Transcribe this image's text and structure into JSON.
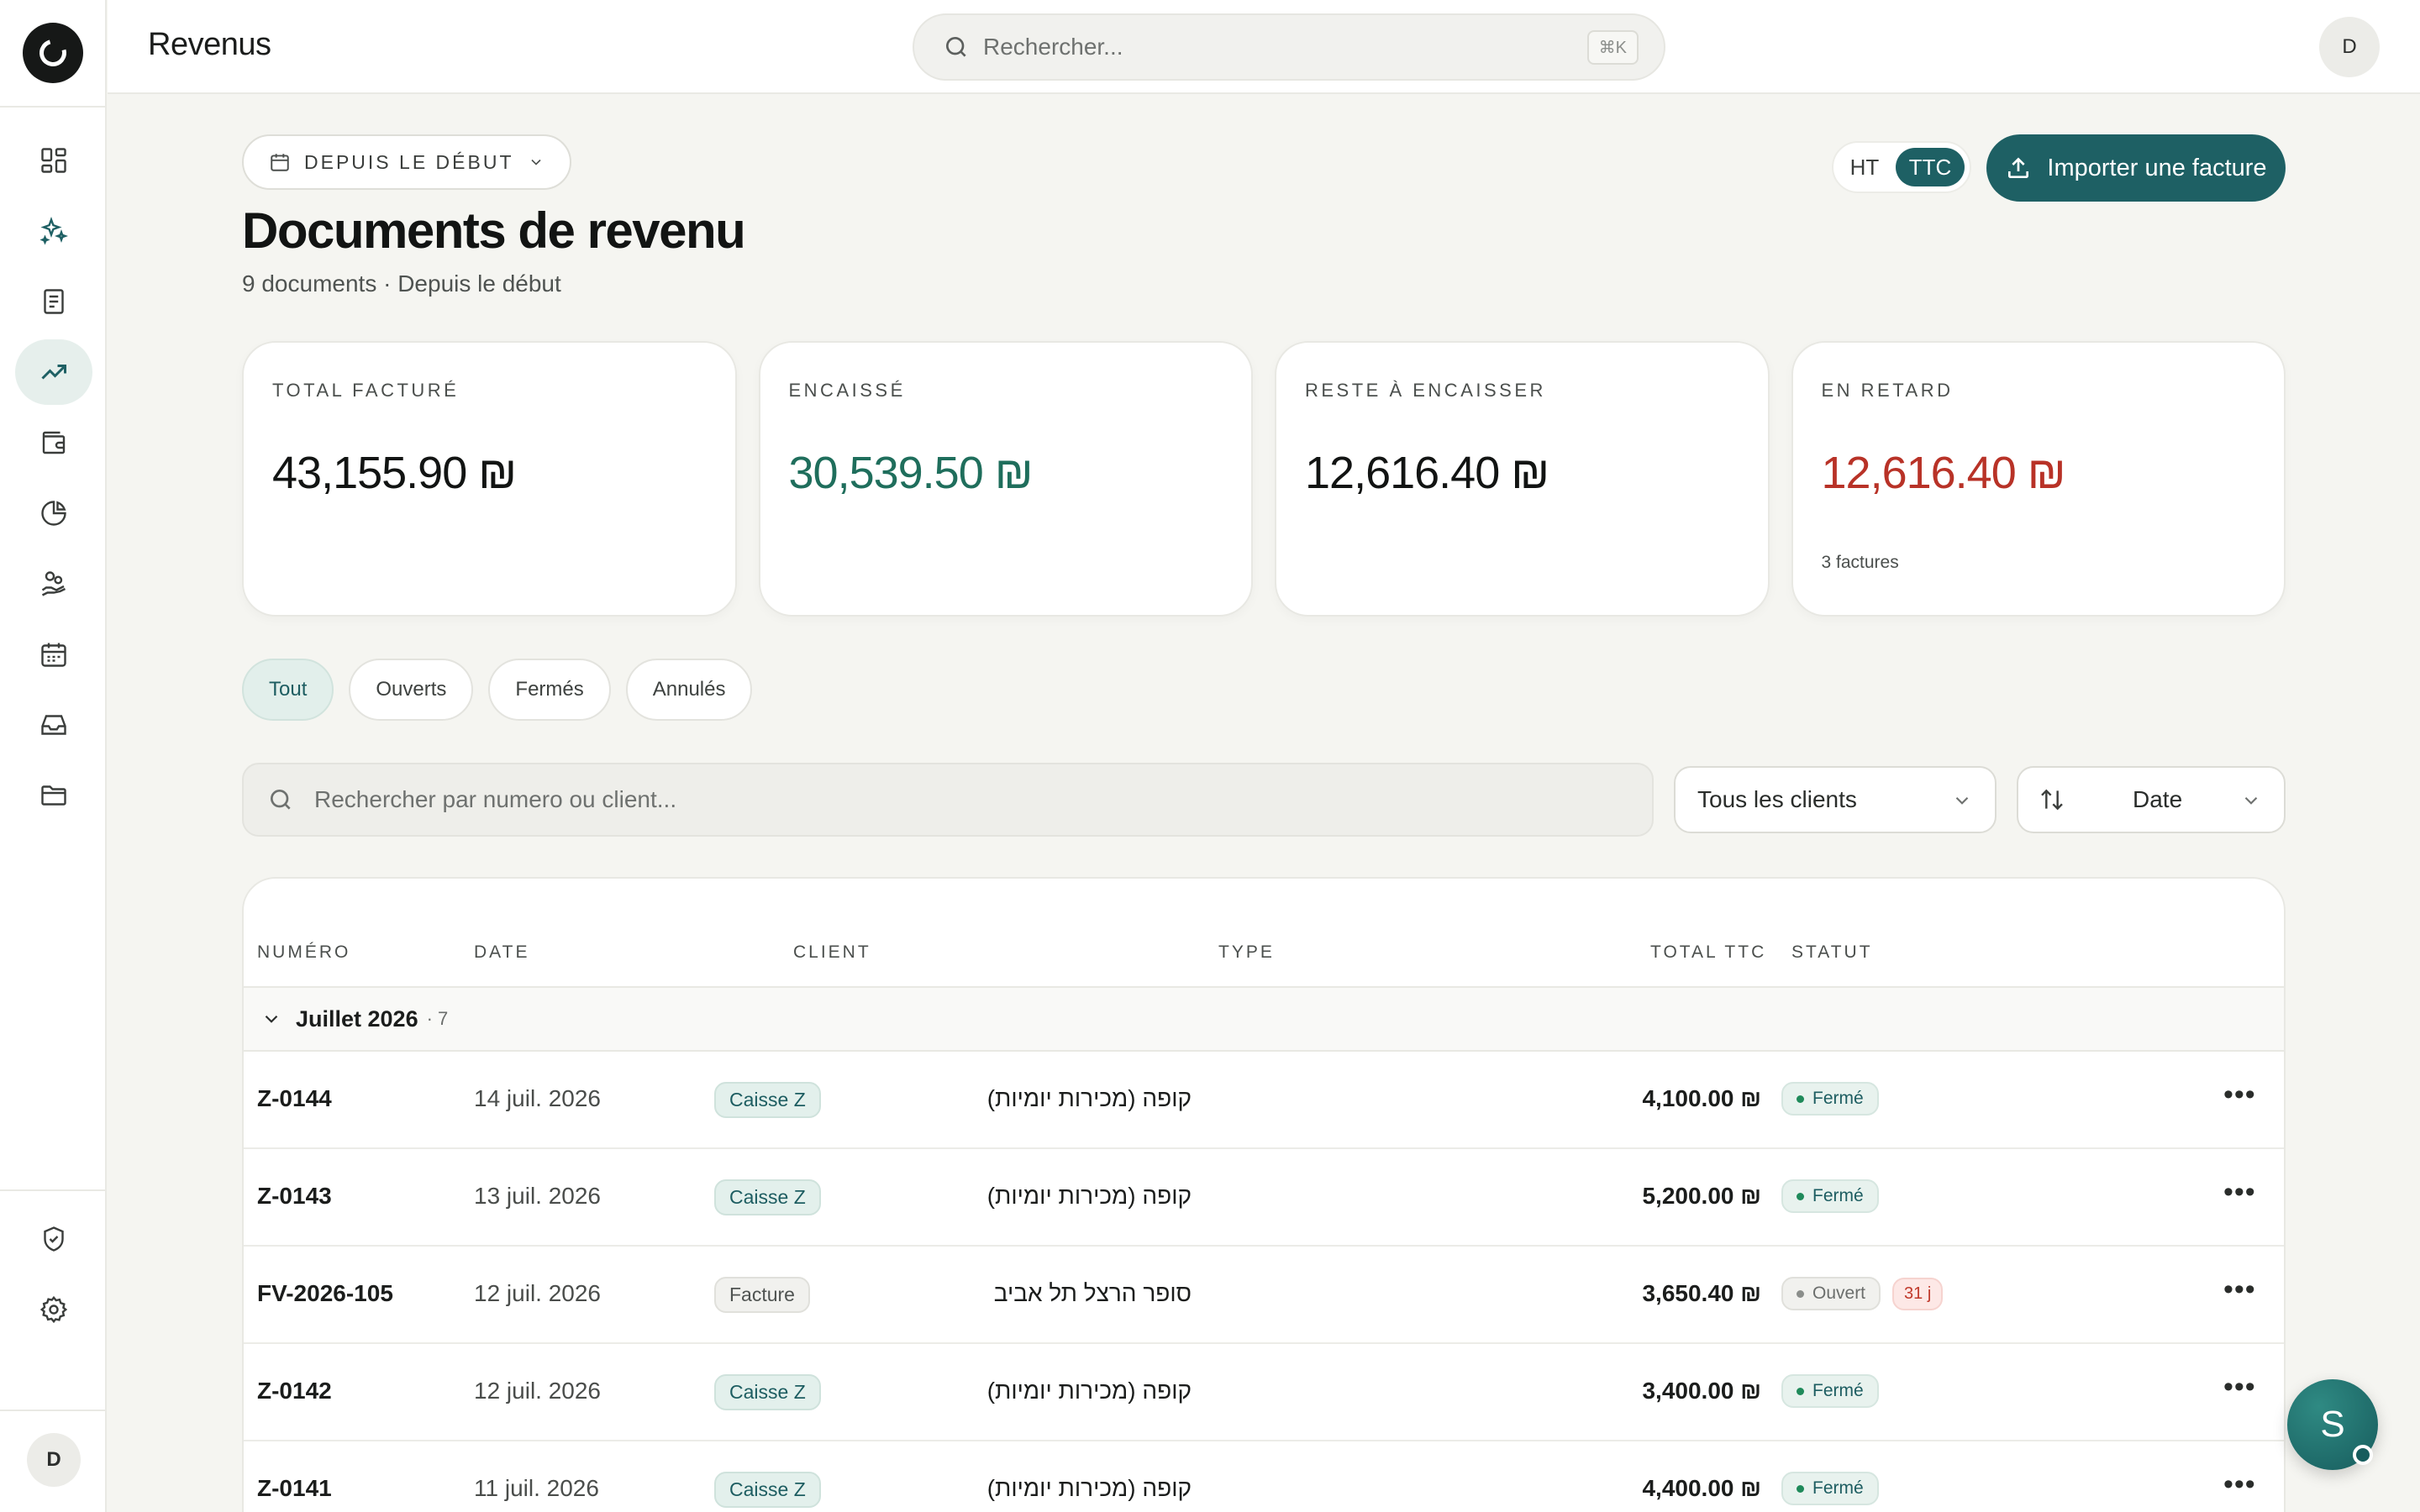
{
  "topbar": {
    "title": "Revenus",
    "search_placeholder": "Rechercher...",
    "search_shortcut": "⌘K",
    "avatar_initial": "D"
  },
  "sidebar": {
    "avatar_initial": "D",
    "items": [
      {
        "icon": "dashboard-grid-icon",
        "active": false
      },
      {
        "icon": "sparkles-icon",
        "active": false
      },
      {
        "icon": "document-icon",
        "active": false
      },
      {
        "icon": "trending-up-icon",
        "active": true
      },
      {
        "icon": "wallet-icon",
        "active": false
      },
      {
        "icon": "pie-chart-icon",
        "active": false
      },
      {
        "icon": "hand-coins-icon",
        "active": false
      },
      {
        "icon": "calendar-icon",
        "active": false
      },
      {
        "icon": "inbox-icon",
        "active": false
      },
      {
        "icon": "folder-icon",
        "active": false
      }
    ],
    "bottom_items": [
      {
        "icon": "shield-check-icon"
      },
      {
        "icon": "gear-icon"
      }
    ]
  },
  "header": {
    "period_label": "DEPUIS LE DÉBUT",
    "title": "Documents de revenu",
    "subtitle": "9 documents · Depuis le début",
    "toggle": {
      "ht": "HT",
      "ttc": "TTC",
      "selected": "TTC"
    },
    "import_label": "Importer une facture"
  },
  "kpis": [
    {
      "label": "TOTAL FACTURÉ",
      "value": "43,155.90 ₪",
      "color": "#121413",
      "note": ""
    },
    {
      "label": "ENCAISSÉ",
      "value": "30,539.50 ₪",
      "color": "#1f6e5c",
      "note": ""
    },
    {
      "label": "RESTE À ENCAISSER",
      "value": "12,616.40 ₪",
      "color": "#121413",
      "note": ""
    },
    {
      "label": "EN RETARD",
      "value": "12,616.40 ₪",
      "color": "#b83227",
      "note": "3 factures"
    }
  ],
  "filters": {
    "tabs": [
      {
        "label": "Tout",
        "active": true
      },
      {
        "label": "Ouverts",
        "active": false
      },
      {
        "label": "Fermés",
        "active": false
      },
      {
        "label": "Annulés",
        "active": false
      }
    ],
    "search_placeholder": "Rechercher par numero ou client...",
    "client_select": "Tous les clients",
    "sort_select": "Date"
  },
  "table": {
    "headers": {
      "numero": "NUMÉRO",
      "date": "DATE",
      "client": "CLIENT",
      "type": "TYPE",
      "total": "TOTAL TTC",
      "statut": "STATUT"
    },
    "group": {
      "title": "Juillet 2026",
      "count": "· 7"
    },
    "rows": [
      {
        "numero": "Z-0144",
        "date": "14 juil. 2026",
        "client": "קופה (מכירות יומיות)",
        "type": "Caisse Z",
        "type_kind": "caisse",
        "total": "4,100.00 ₪",
        "status": "Fermé",
        "status_kind": "closed",
        "late": ""
      },
      {
        "numero": "Z-0143",
        "date": "13 juil. 2026",
        "client": "קופה (מכירות יומיות)",
        "type": "Caisse Z",
        "type_kind": "caisse",
        "total": "5,200.00 ₪",
        "status": "Fermé",
        "status_kind": "closed",
        "late": ""
      },
      {
        "numero": "FV-2026-105",
        "date": "12 juil. 2026",
        "client": "סופר הרצל תל אביב",
        "type": "Facture",
        "type_kind": "facture",
        "total": "3,650.40 ₪",
        "status": "Ouvert",
        "status_kind": "open",
        "late": "31 j"
      },
      {
        "numero": "Z-0142",
        "date": "12 juil. 2026",
        "client": "קופה (מכירות יומיות)",
        "type": "Caisse Z",
        "type_kind": "caisse",
        "total": "3,400.00 ₪",
        "status": "Fermé",
        "status_kind": "closed",
        "late": ""
      },
      {
        "numero": "Z-0141",
        "date": "11 juil. 2026",
        "client": "קופה (מכירות יומיות)",
        "type": "Caisse Z",
        "type_kind": "caisse",
        "total": "4,400.00 ₪",
        "status": "Fermé",
        "status_kind": "closed",
        "late": ""
      }
    ],
    "more_glyph": "•••"
  },
  "chat": {
    "initial": "S"
  },
  "colors": {
    "accent": "#1e6064",
    "success": "#1f6e5c",
    "danger": "#b83227"
  }
}
